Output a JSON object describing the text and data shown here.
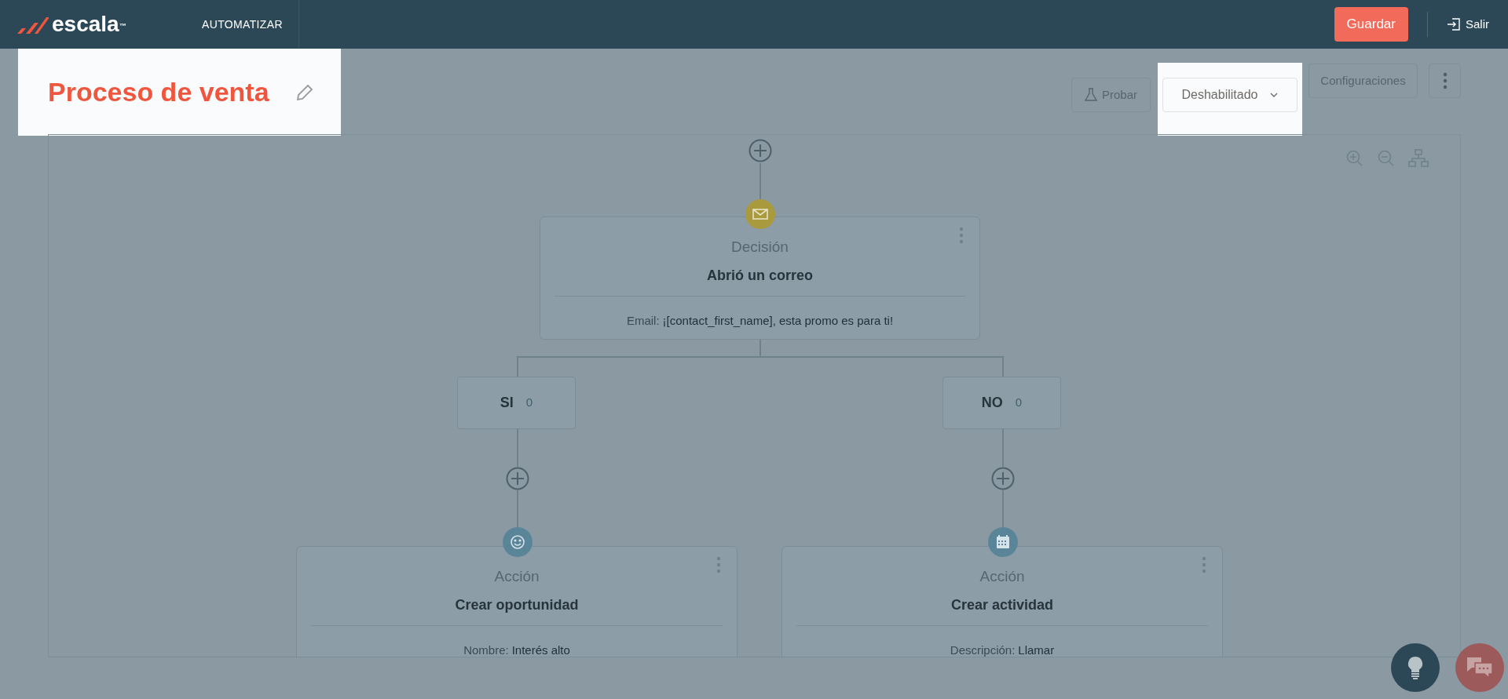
{
  "header": {
    "logo": {
      "name": "escala",
      "mark": "™"
    },
    "nav": "AUTOMATIZAR",
    "save": "Guardar",
    "exit": "Salir"
  },
  "title": {
    "text": "Proceso de venta",
    "highlighted": true
  },
  "toolbar": {
    "test": "Probar",
    "status": {
      "value": "Deshabilitado",
      "highlighted": true
    },
    "settings": "Configuraciones"
  },
  "decision": {
    "kind": "email",
    "type": "Decisión",
    "title": "Abrió un correo",
    "detail_label": "Email:",
    "detail_value": "¡[contact_first_name], esta promo es para ti!"
  },
  "branches": [
    {
      "label": "SI",
      "count": "0",
      "action": {
        "kind": "opportunity",
        "type": "Acción",
        "title": "Crear oportunidad",
        "detail_label": "Nombre:",
        "detail_value": "Interés alto"
      }
    },
    {
      "label": "NO",
      "count": "0",
      "action": {
        "kind": "activity",
        "type": "Acción",
        "title": "Crear actividad",
        "detail_label": "Descripción:",
        "detail_value": "Llamar"
      }
    }
  ]
}
